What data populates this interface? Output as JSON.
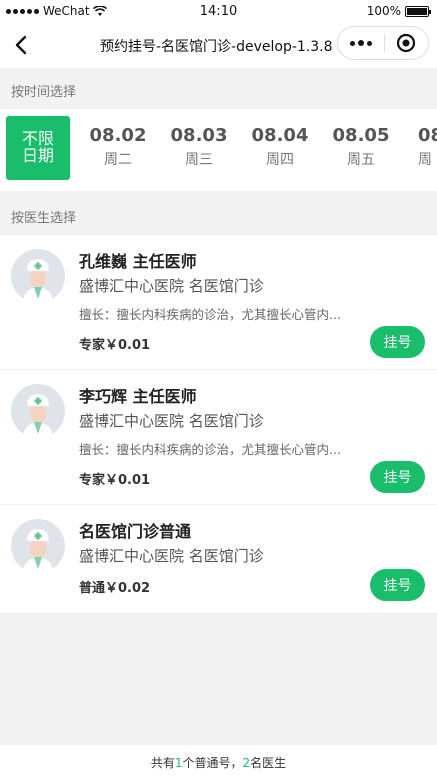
{
  "status_bar": {
    "carrier": "WeChat",
    "time": "14:10",
    "battery_percent": "100%"
  },
  "nav": {
    "title": "预约挂号-名医馆门诊-develop-1.3.8"
  },
  "sections": {
    "time_label": "按时间选择",
    "doctor_label": "按医生选择"
  },
  "dates": {
    "any_label": "不限日期",
    "items": [
      {
        "date": "08.02",
        "weekday": "周二"
      },
      {
        "date": "08.03",
        "weekday": "周三"
      },
      {
        "date": "08.04",
        "weekday": "周四"
      },
      {
        "date": "08.05",
        "weekday": "周五"
      },
      {
        "date": "08",
        "weekday": "周"
      }
    ]
  },
  "doctors": [
    {
      "name": "孔维巍  主任医师",
      "hospital": "盛博汇中心医院  名医馆门诊",
      "skill": "擅长：擅长内科疾病的诊治，尤其擅长心管内...",
      "price": "专家￥0.01",
      "button": "挂号"
    },
    {
      "name": "李巧辉  主任医师",
      "hospital": "盛博汇中心医院  名医馆门诊",
      "skill": "擅长：擅长内科疾病的诊治，尤其擅长心管内...",
      "price": "专家￥0.01",
      "button": "挂号"
    },
    {
      "name": "名医馆门诊普通",
      "hospital": "盛博汇中心医院  名医馆门诊",
      "price": "普通￥0.02",
      "button": "挂号"
    }
  ],
  "footer": {
    "prefix": "共有",
    "normal_count": "1",
    "mid": "个普通号，",
    "doctor_count": "2",
    "suffix": "名医生"
  },
  "colors": {
    "accent": "#19be6b"
  },
  "icons": {
    "back": "chevron-left-icon",
    "more": "more-dots-icon",
    "close": "target-close-icon",
    "avatar": "doctor-avatar-icon"
  }
}
